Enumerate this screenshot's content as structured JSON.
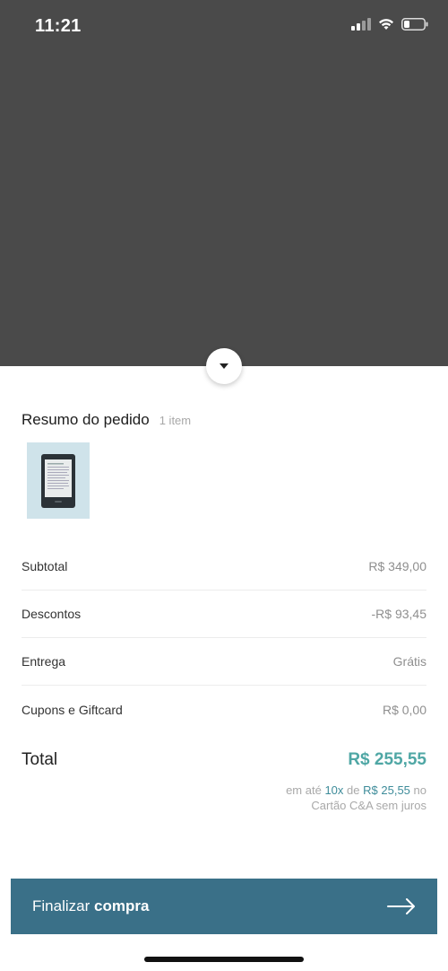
{
  "status_bar": {
    "time": "11:21"
  },
  "summary": {
    "title": "Resumo do pedido",
    "item_count": "1 item"
  },
  "rows": [
    {
      "label": "Subtotal",
      "value": "R$ 349,00"
    },
    {
      "label": "Descontos",
      "value": "-R$ 93,45"
    },
    {
      "label": "Entrega",
      "value": "Grátis"
    },
    {
      "label": "Cupons e Giftcard",
      "value": "R$ 0,00"
    }
  ],
  "total": {
    "label": "Total",
    "value": "R$ 255,55"
  },
  "installments": {
    "prefix": "em até",
    "count": "10x",
    "middle": "de",
    "amount": "R$ 25,55",
    "suffix": "no",
    "line2": "Cartão C&A sem juros"
  },
  "checkout": {
    "label_regular": "Finalizar",
    "label_bold": "compra"
  },
  "colors": {
    "accent": "#4fa7a5",
    "button": "#3a7088",
    "overlay": "#4a4a4a"
  },
  "icons": {
    "collapse": "chevron-down-icon",
    "checkout": "arrow-right-icon",
    "product": "ereader-thumbnail"
  }
}
